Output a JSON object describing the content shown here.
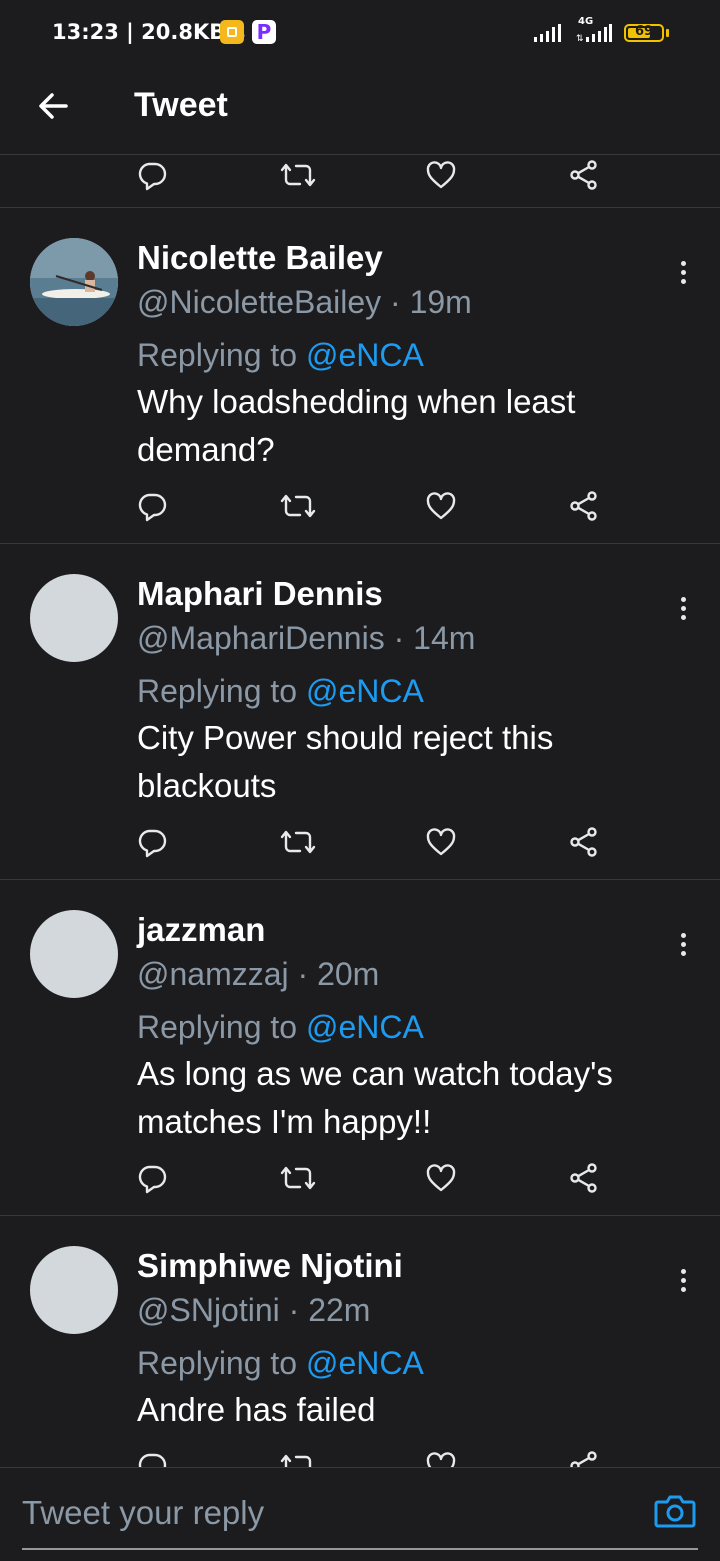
{
  "status_bar": {
    "time": "13:23 | 20.8KB/s",
    "network_label": "4G",
    "battery": "69",
    "battery_level": 0.69
  },
  "header": {
    "title": "Tweet"
  },
  "tweets": [
    {
      "name": "Nicolette Bailey",
      "handle": "@NicoletteBailey",
      "time": "19m",
      "meta": "@NicoletteBailey · 19m",
      "replying_prefix": "Replying to ",
      "replying_to": "@eNCA",
      "text": "Why loadshedding when least demand?"
    },
    {
      "name": "Maphari Dennis",
      "handle": "@MaphariDennis",
      "time": "14m",
      "meta": "@MaphariDennis · 14m",
      "replying_prefix": "Replying to ",
      "replying_to": "@eNCA",
      "text": "City Power should reject this blackouts"
    },
    {
      "name": "jazzman",
      "handle": "@namzzaj",
      "time": "20m",
      "meta": "@namzzaj · 20m",
      "replying_prefix": "Replying to ",
      "replying_to": "@eNCA",
      "text": "As long as we can watch today's matches I'm happy!!"
    },
    {
      "name": "Simphiwe Njotini",
      "handle": "@SNjotini",
      "time": "22m",
      "meta": "@SNjotini · 22m",
      "replying_prefix": "Replying to ",
      "replying_to": "@eNCA",
      "text": "Andre has failed"
    }
  ],
  "reply_bar": {
    "placeholder": "Tweet your reply"
  },
  "colors": {
    "background": "#1c1c1e",
    "text": "#ffffff",
    "secondary_text": "#8b98a5",
    "link": "#1d9bf0",
    "divider": "#38383a"
  },
  "icons": [
    "back-arrow-icon",
    "reply-icon",
    "retweet-icon",
    "like-icon",
    "share-icon",
    "more-options-icon",
    "camera-icon",
    "signal-icon",
    "battery-icon"
  ]
}
